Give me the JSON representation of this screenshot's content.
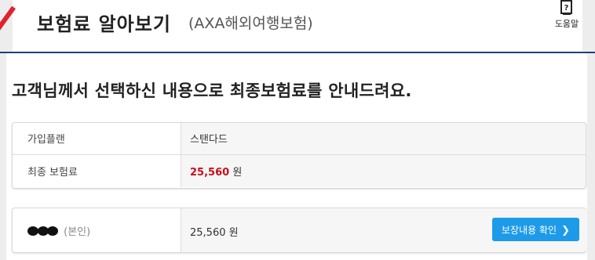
{
  "header": {
    "title": "보험료 알아보기",
    "subtitle": "(AXA해외여행보험)",
    "help_label": "도움말"
  },
  "notice": "고객님께서 선택하신 내용으로 최종보험료를 안내드려요.",
  "summary": {
    "plan_label": "가입플랜",
    "plan_value": "스탠다드",
    "premium_label": "최종 보험료",
    "premium_amount": "25,560",
    "premium_unit": "원"
  },
  "insured": {
    "relation": "(본인)",
    "amount": "25,560",
    "unit": "원",
    "button_label": "보장내용 확인",
    "button_icon": "chevron-right-icon"
  },
  "colors": {
    "accent": "#1f3f7a",
    "price": "#c8101c",
    "button": "#1d9be8",
    "brand_slash": "#e0212f"
  }
}
